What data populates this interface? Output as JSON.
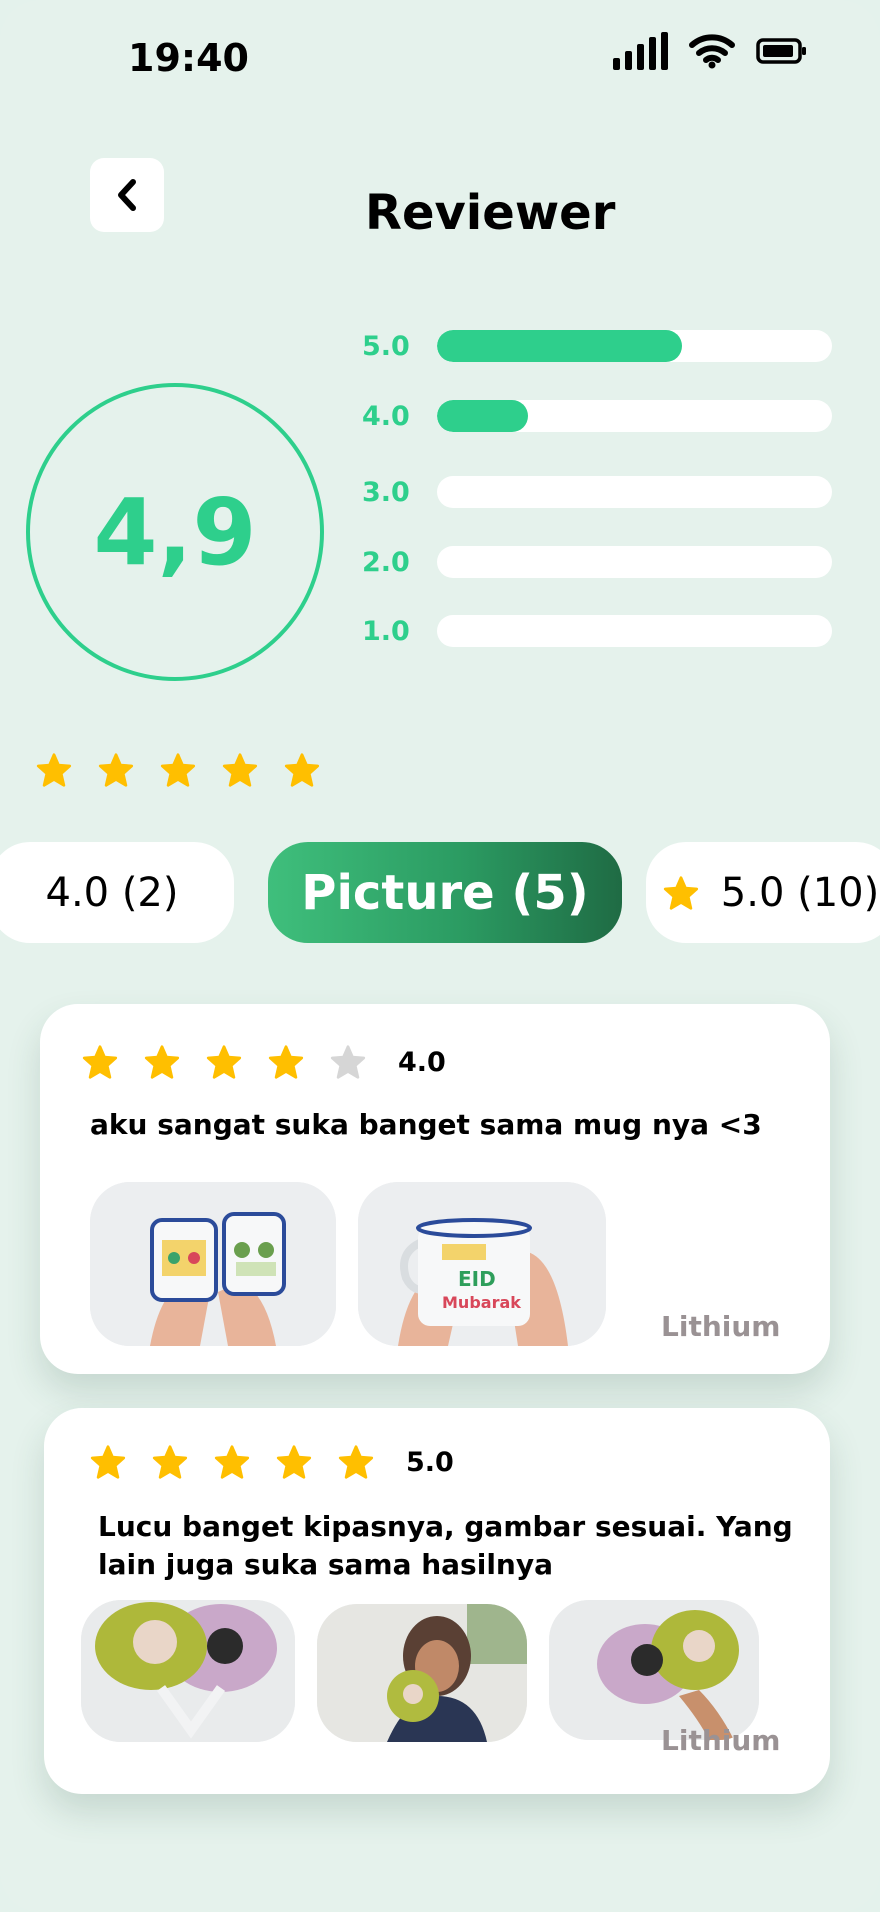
{
  "status_bar": {
    "time": "19:40"
  },
  "header": {
    "title": "Reviewer"
  },
  "summary": {
    "average": "4,9",
    "bars": [
      {
        "label": "5.0",
        "fraction": 0.62
      },
      {
        "label": "4.0",
        "fraction": 0.23
      },
      {
        "label": "3.0",
        "fraction": 0
      },
      {
        "label": "2.0",
        "fraction": 0
      },
      {
        "label": "1.0",
        "fraction": 0
      }
    ],
    "stars_filled": 5
  },
  "filters": [
    {
      "label": "4.0 (2)",
      "active": false
    },
    {
      "label": "Picture (5)",
      "active": true
    },
    {
      "label": "5.0 (10)",
      "active": false,
      "icon": "star-icon"
    }
  ],
  "reviews": [
    {
      "rating": "4.0",
      "stars_filled": 4,
      "text": "aku sangat suka banget sama mug nya <3",
      "author": "Lithium",
      "photos": [
        "mug-photo",
        "mug-photo"
      ]
    },
    {
      "rating": "5.0",
      "stars_filled": 5,
      "text": "Lucu banget kipasnya, gambar sesuai. Yang lain juga suka sama hasilnya",
      "author": "Lithium",
      "photos": [
        "fan-photo",
        "fan-photo",
        "fan-photo"
      ]
    }
  ],
  "colors": {
    "background": "#e5f2ec",
    "accent": "#2ecf8c",
    "star": "#ffbf00",
    "star_empty": "#d6d6d6",
    "chip_active_start": "#3fbf7c",
    "chip_active_end": "#1f6b44"
  }
}
